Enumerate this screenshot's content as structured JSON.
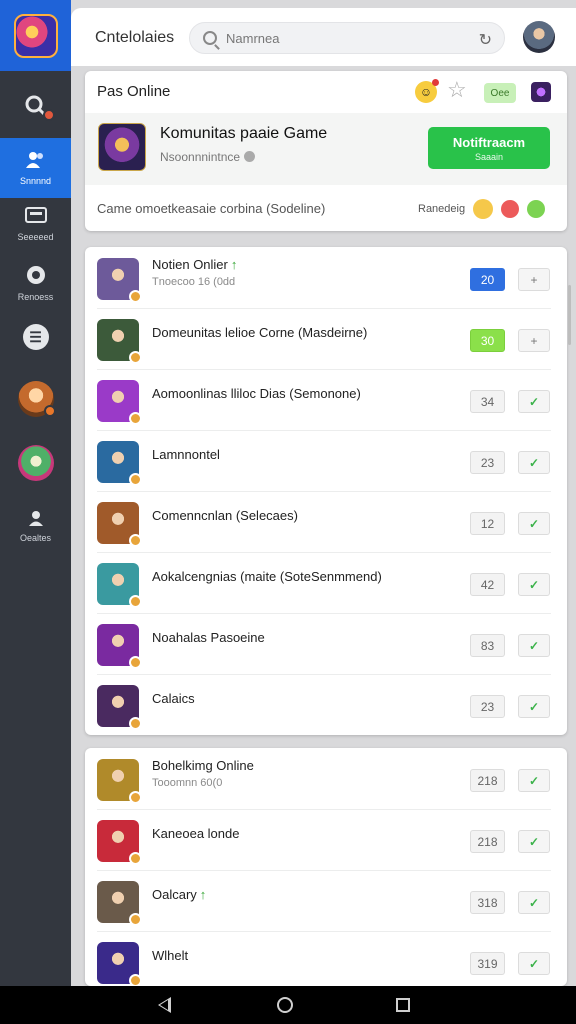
{
  "app": {
    "title": "Cntelolaies"
  },
  "search": {
    "placeholder": "Namrnea"
  },
  "rail": {
    "items": [
      {
        "label": "",
        "icon": "search-icon"
      },
      {
        "label": "Snnnnd",
        "icon": "users-icon"
      },
      {
        "label": "Seeeeed",
        "icon": "monitor-icon"
      },
      {
        "label": "Renoess",
        "icon": "compass-icon"
      },
      {
        "label": "",
        "icon": "chat-icon"
      },
      {
        "label": "",
        "icon": "avatar-icon"
      },
      {
        "label": "",
        "icon": "avatar-icon"
      },
      {
        "label": "Oealtes",
        "icon": "profile-icon"
      }
    ]
  },
  "card1": {
    "title": "Pas Online",
    "pill": "Oee",
    "featured": {
      "title": "Komunitas paaie Game",
      "subtitle": "Nsoonnnintnce",
      "button_line1": "Notiftraacm",
      "button_line2": "Saaain"
    },
    "status": "Came omoetkeasaie corbina (Sodeline)",
    "react_label": "Ranedeig"
  },
  "list": [
    {
      "title": "Notien Onlier",
      "sub": "Tnoecoo 16 (0dd",
      "count": "20",
      "action": "+",
      "style": "blue",
      "trend": "↑",
      "thumb": "#6d5a9a"
    },
    {
      "title": "Domeunitas lelioe Corne (Masdeirne)",
      "sub": "",
      "count": "30",
      "action": "+",
      "style": "green",
      "trend": "",
      "thumb": "#3c5a3a"
    },
    {
      "title": "Aomoonlinas lliloc Dias (Semonone)",
      "sub": "",
      "count": "34",
      "action": "✓",
      "style": "",
      "trend": "",
      "thumb": "#9a3ac8"
    },
    {
      "title": "Lamnnontel",
      "sub": "",
      "count": "23",
      "action": "✓",
      "style": "",
      "trend": "",
      "thumb": "#2a6aa0"
    },
    {
      "title": "Comenncnlan (Selecaes)",
      "sub": "",
      "count": "12",
      "action": "✓",
      "style": "",
      "trend": "",
      "thumb": "#a05a2a"
    },
    {
      "title": "Aokalcengnias (maite (SoteSenmmend)",
      "sub": "",
      "count": "42",
      "action": "✓",
      "style": "",
      "trend": "",
      "thumb": "#3a9aa0"
    },
    {
      "title": "Noahalas Pasoeine",
      "sub": "",
      "count": "83",
      "action": "✓",
      "style": "",
      "trend": "",
      "thumb": "#7a2aa0"
    },
    {
      "title": "Calaics",
      "sub": "",
      "count": "23",
      "action": "✓",
      "style": "",
      "trend": "",
      "thumb": "#4a2a60"
    }
  ],
  "list2": [
    {
      "title": "Bohelkimg Online",
      "sub": "Tooomnn 60(0",
      "count": "218",
      "action": "✓",
      "trend": "",
      "thumb": "#b08a2a"
    },
    {
      "title": "Kaneoea londe",
      "sub": "",
      "count": "218",
      "action": "✓",
      "trend": "",
      "thumb": "#c82a3a"
    },
    {
      "title": "Oalcary",
      "sub": "",
      "count": "318",
      "action": "✓",
      "trend": "↑",
      "thumb": "#6a5a4a"
    },
    {
      "title": "Wlhelt",
      "sub": "",
      "count": "319",
      "action": "✓",
      "trend": "",
      "thumb": "#3a2a8a"
    }
  ],
  "colors": {
    "accent": "#1f6fe0",
    "rail": "#33373f",
    "notify": "#29c24a"
  }
}
